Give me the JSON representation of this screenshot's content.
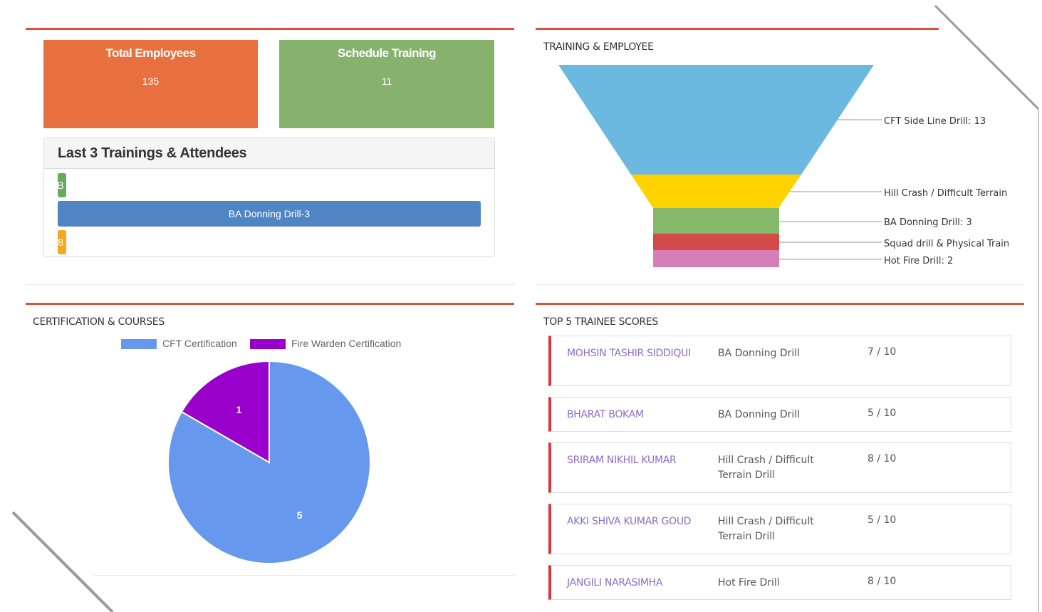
{
  "stats": {
    "total_employees": {
      "label": "Total Employees",
      "value": "135",
      "color": "#e8703f"
    },
    "schedule_training": {
      "label": "Schedule Training",
      "value": "11",
      "color": "#86b26e"
    }
  },
  "trainings": {
    "title": "Last 3 Trainings & Attendees",
    "bars": [
      {
        "label": "B",
        "color": "#6aa85f"
      },
      {
        "label": "BA Donning Drill-3",
        "color": "#4f85c2"
      },
      {
        "label": "8",
        "color": "#f5a623"
      }
    ]
  },
  "funnel": {
    "title": "TRAINING & EMPLOYEE",
    "labels": [
      "CFT Side Line Drill: 13",
      "Hill Crash / Difficult Terrain",
      "BA Donning Drill: 3",
      "Squad drill & Physical Train",
      "Hot Fire Drill: 2"
    ],
    "colors": [
      "#6bb9e0",
      "#ffd200",
      "#86b86a",
      "#d24a4a",
      "#d67fb6"
    ]
  },
  "certification": {
    "title": "CERTIFICATION & COURSES"
  },
  "scores": {
    "title": "TOP 5 TRAINEE SCORES",
    "rows": [
      {
        "name": "MOHSIN TASHIR SIDDIQUI",
        "course": "BA Donning Drill",
        "score": "7 / 10"
      },
      {
        "name": "BHARAT BOKAM",
        "course": "BA Donning Drill",
        "score": "5 / 10"
      },
      {
        "name": "SRIRAM NIKHIL KUMAR",
        "course": "Hill Crash / Difficult Terrain Drill",
        "score": "8 / 10"
      },
      {
        "name": "AKKI SHIVA KUMAR GOUD",
        "course": "Hill Crash / Difficult Terrain Drill",
        "score": "5 / 10"
      },
      {
        "name": "JANGILI NARASIMHA",
        "course": "Hot Fire Drill",
        "score": "8 / 10"
      }
    ]
  },
  "chart_data": {
    "type": "pie",
    "categories": [
      "CFT Certification",
      "Fire Warden Certification"
    ],
    "values": [
      5,
      1
    ],
    "colors": [
      "#6699ee",
      "#9900cc"
    ],
    "legend": "top"
  }
}
